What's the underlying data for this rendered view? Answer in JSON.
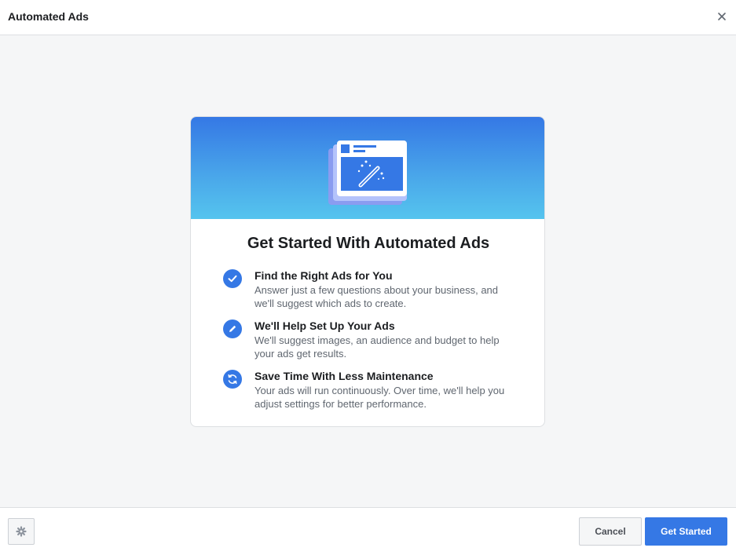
{
  "header": {
    "title": "Automated Ads",
    "close_icon": "close-icon"
  },
  "card": {
    "illustration_icon": "magic-wand-ad-icon",
    "title": "Get Started With Automated Ads",
    "features": [
      {
        "icon": "checkmark-icon",
        "title": "Find the Right Ads for You",
        "description": "Answer just a few questions about your business, and we'll suggest which ads to create."
      },
      {
        "icon": "pencil-icon",
        "title": "We'll Help Set Up Your Ads",
        "description": "We'll suggest images, an audience and budget to help your ads get results."
      },
      {
        "icon": "refresh-icon",
        "title": "Save Time With Less Maintenance",
        "description": "Your ads will run continuously. Over time, we'll help you adjust settings for better performance."
      }
    ]
  },
  "footer": {
    "settings_icon": "gear-icon",
    "cancel_label": "Cancel",
    "primary_label": "Get Started"
  },
  "colors": {
    "accent": "#3578e5",
    "content_background": "#f5f6f7",
    "banner_gradient_top": "#3578e5",
    "banner_gradient_bottom": "#55c4ee"
  }
}
